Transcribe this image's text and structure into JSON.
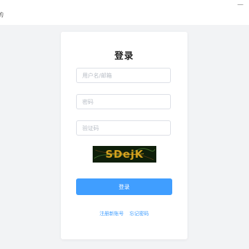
{
  "window": {
    "corner_text": "的",
    "close_symbol": "—"
  },
  "login": {
    "title": "登录",
    "username_placeholder": "用户名/邮箱",
    "password_placeholder": "密码",
    "captcha_placeholder": "验证码",
    "captcha_text": "SDejK",
    "submit_label": "登录",
    "register_link": "注册新账号",
    "forgot_link": "忘记密码"
  },
  "colors": {
    "accent": "#409eff",
    "page_background": "#f2f3f5",
    "captcha_background": "#0f1f0a",
    "captcha_text": "#d4a21f"
  }
}
